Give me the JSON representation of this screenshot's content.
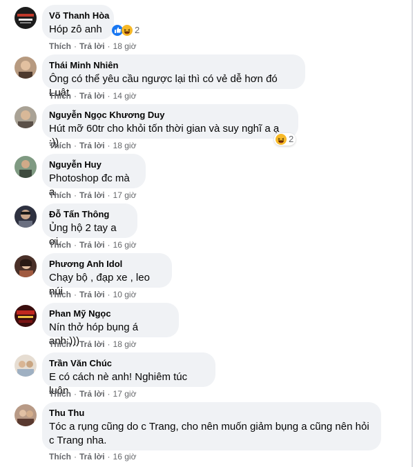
{
  "comments": [
    {
      "author": "Võ Thanh Hòa",
      "text": "Hóp zô anh",
      "like": "Thích",
      "reply": "Trả lời",
      "time": "18 giờ",
      "reaction_count": "2",
      "reactions": [
        "like-icon",
        "haha-icon"
      ],
      "avatar_color": "#1c1c1c"
    },
    {
      "author": "Thái Minh Nhiên",
      "text": "Ông có thể yêu cầu ngược lại thì có vẻ dễ hơn đó Luật",
      "like": "Thích",
      "reply": "Trả lời",
      "time": "14 giờ",
      "avatar_color": "#8a6a52"
    },
    {
      "author": "Nguyễn Ngọc Khương Duy",
      "text": "Hút mỡ 60tr cho khỏi tốn thời gian và suy nghĩ a ạ :))",
      "like": "Thích",
      "reply": "Trả lời",
      "time": "18 giờ",
      "reaction_count": "2",
      "reactions": [
        "haha-icon"
      ],
      "avatar_color": "#7d7a72"
    },
    {
      "author": "Nguyễn Huy",
      "text": "Photoshop đc mà a",
      "like": "Thích",
      "reply": "Trả lời",
      "time": "17 giờ",
      "avatar_color": "#5f7360"
    },
    {
      "author": "Đỗ Tấn Thông",
      "text": "Ủng hộ 2 tay a ơi.",
      "like": "Thích",
      "reply": "Trả lời",
      "time": "16 giờ",
      "avatar_color": "#3a3d4a"
    },
    {
      "author": "Phương Anh Idol",
      "text": "Chạy bộ , đạp xe , leo núi",
      "like": "Thích",
      "reply": "Trả lời",
      "time": "10 giờ",
      "avatar_color": "#6b4a3a"
    },
    {
      "author": "Phan Mỹ Ngọc",
      "text": "Nín thở hóp bụng á anh:)))",
      "like": "Thích",
      "reply": "Trả lời",
      "time": "18 giờ",
      "avatar_color": "#8a1e1e"
    },
    {
      "author": "Trần Văn Chúc",
      "text": "E có cách nè anh! Nghiêm túc luôn",
      "like": "Thích",
      "reply": "Trả lời",
      "time": "17 giờ",
      "avatar_color": "#c9b8a8"
    },
    {
      "author": "Thu Thu",
      "text": "Tóc a rụng cũng do c Trang, cho nên muốn giảm bụng a cũng nên hỏi c Trang nha.",
      "like": "Thích",
      "reply": "Trả lời",
      "time": "16 giờ",
      "avatar_color": "#9a7a66"
    }
  ],
  "colors": {
    "bubble": "#f0f2f5",
    "secondary_text": "#65676b",
    "primary_text": "#050505",
    "like_blue": "#1877f2",
    "haha_yellow": "#f7b928"
  }
}
